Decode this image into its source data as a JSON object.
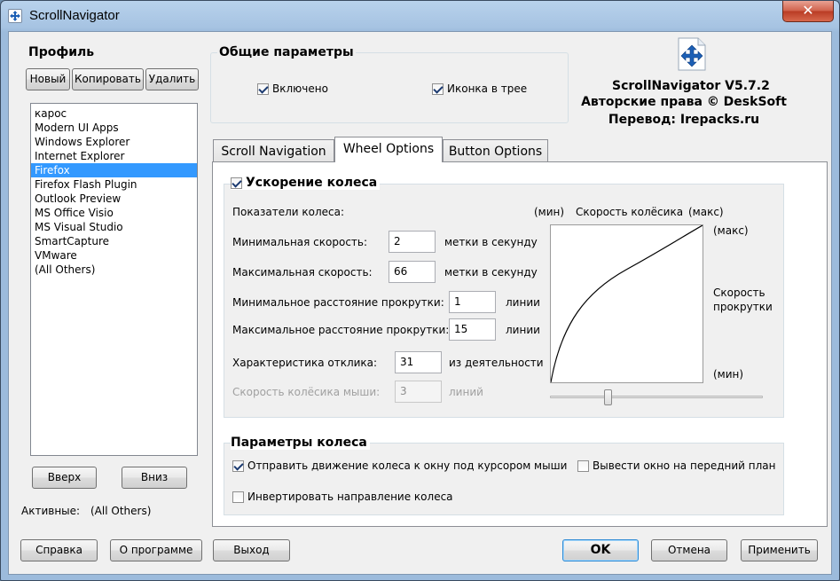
{
  "window": {
    "title": "ScrollNavigator",
    "close_glyph": "✕"
  },
  "profile": {
    "heading": "Профиль",
    "new_label": "Новый",
    "copy_label": "Копировать",
    "delete_label": "Удалить",
    "items": [
      "карос",
      "Modern UI Apps",
      "Windows Explorer",
      "Internet Explorer",
      "Firefox",
      "Firefox Flash Plugin",
      "Outlook Preview",
      "MS Office Visio",
      "MS Visual Studio",
      "SmartCapture",
      "VMware",
      "(All Others)"
    ],
    "selected_index": 4,
    "up_label": "Вверх",
    "down_label": "Вниз",
    "active_label": "Активные:",
    "active_value": "(All Others)"
  },
  "general": {
    "heading": "Общие параметры",
    "enabled_label": "Включено",
    "enabled_checked": true,
    "tray_label": "Иконка в трее",
    "tray_checked": true
  },
  "about": {
    "line1": "ScrollNavigator V5.7.2",
    "line2": "Авторские права © DeskSoft",
    "line3": "Перевод: Irepacks.ru",
    "logo_icon": "move-arrows-icon"
  },
  "tabs": [
    {
      "label": "Scroll Navigation",
      "active": false
    },
    {
      "label": "Wheel Options",
      "active": true
    },
    {
      "label": "Button Options",
      "active": false
    }
  ],
  "wheel_accel": {
    "heading": "Ускорение колеса",
    "checked": true,
    "indicators_label": "Показатели колеса:",
    "min_speed_label": "Минимальная скорость:",
    "min_speed_value": "2",
    "min_speed_unit": "метки в секунду",
    "max_speed_label": "Максимальная скорость:",
    "max_speed_value": "66",
    "max_speed_unit": "метки в секунду",
    "min_dist_label": "Минимальное расстояние прокрутки:",
    "min_dist_value": "1",
    "min_dist_unit": "линии",
    "max_dist_label": "Максимальное расстояние прокрутки:",
    "max_dist_value": "15",
    "max_dist_unit": "линии",
    "response_label": "Характеристика отклика:",
    "response_value": "31",
    "response_unit": "из деятельности",
    "mouse_speed_label": "Скорость колёсика мыши:",
    "mouse_speed_value": "3",
    "mouse_speed_unit": "линий",
    "graph_min_top": "(мин)",
    "graph_title": "Скорость колёсика",
    "graph_max_top": "(макс)",
    "graph_max_right": "(макс)",
    "graph_axis_label_1": "Скорость",
    "graph_axis_label_2": "прокрутки",
    "graph_min_right": "(мин)",
    "slider_fraction": 0.27
  },
  "wheel_params": {
    "heading": "Параметры колеса",
    "send_label": "Отправить движение колеса к окну под курсором мыши",
    "send_checked": true,
    "foreground_label": "Вывести окно на передний план",
    "foreground_checked": false,
    "invert_label": "Инвертировать направление колеса",
    "invert_checked": false
  },
  "footer": {
    "help_label": "Справка",
    "about_label": "О программе",
    "exit_label": "Выход",
    "ok_label": "OK",
    "cancel_label": "Отмена",
    "apply_label": "Применить"
  }
}
